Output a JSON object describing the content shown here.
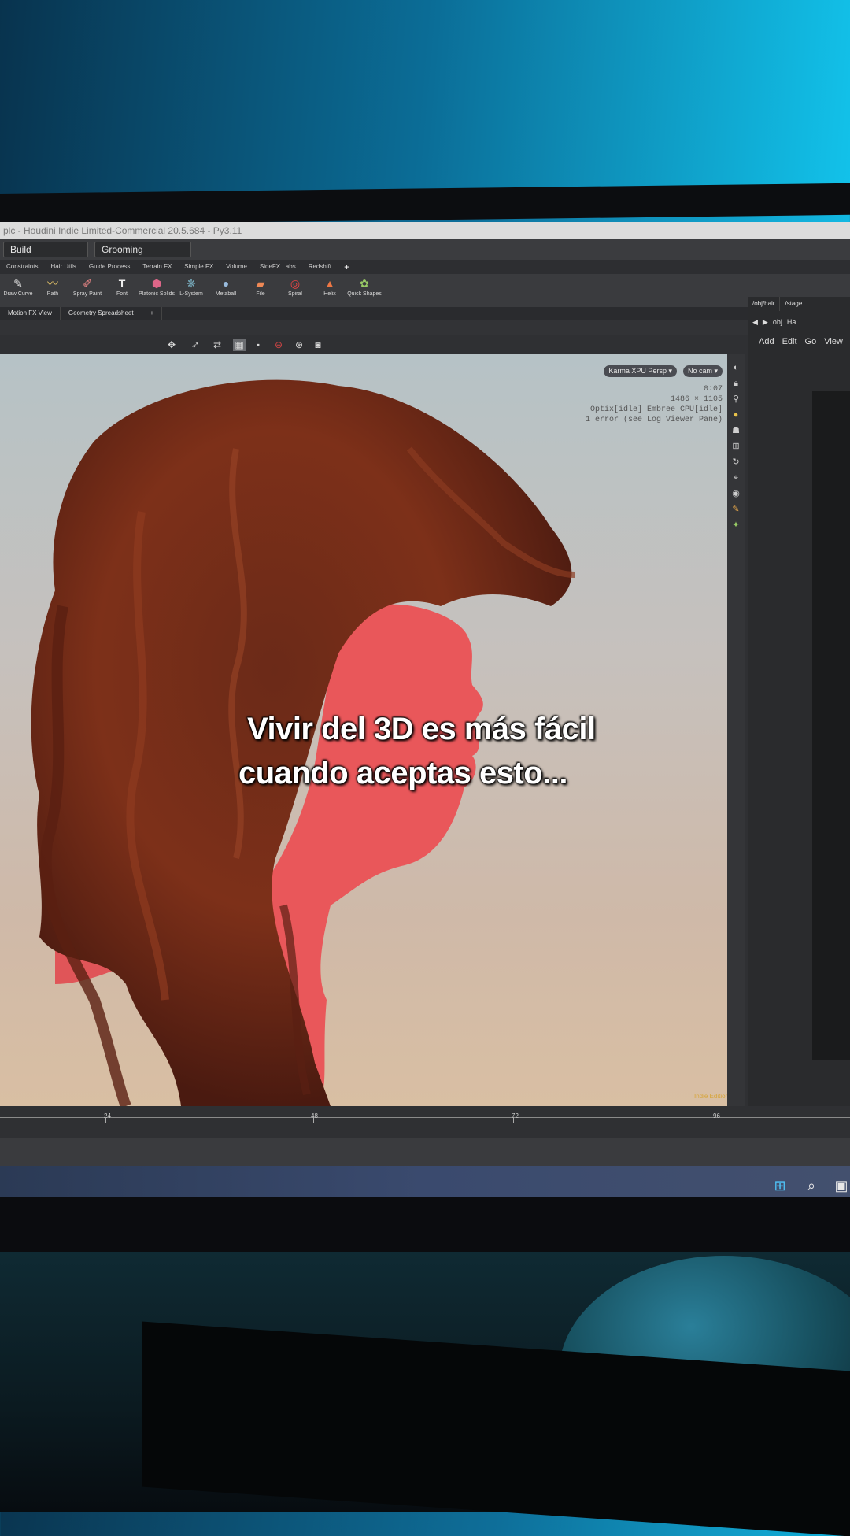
{
  "window": {
    "title": "plc - Houdini Indie Limited-Commercial 20.5.684 - Py3.11"
  },
  "desktop": {
    "build": "Build",
    "grooming": "Grooming"
  },
  "shelf_tabs": [
    "Constraints",
    "Hair Utils",
    "Guide Process",
    "Terrain FX",
    "Simple FX",
    "Volume",
    "SideFX Labs",
    "Redshift",
    "+"
  ],
  "shelf_tools": [
    {
      "label": "Draw Curve",
      "icon": "pencil-icon"
    },
    {
      "label": "Path",
      "icon": "path-icon"
    },
    {
      "label": "Spray Paint",
      "icon": "spray-icon"
    },
    {
      "label": "Font",
      "icon": "font-icon"
    },
    {
      "label": "Platonic Solids",
      "icon": "platonic-icon"
    },
    {
      "label": "L-System",
      "icon": "lsystem-icon"
    },
    {
      "label": "Metaball",
      "icon": "metaball-icon"
    },
    {
      "label": "File",
      "icon": "file-icon"
    },
    {
      "label": "Spiral",
      "icon": "spiral-icon"
    },
    {
      "label": "Helix",
      "icon": "helix-icon"
    },
    {
      "label": "Quick Shapes",
      "icon": "quickshapes-icon"
    }
  ],
  "pane_tabs": [
    "Motion FX View",
    "Geometry Spreadsheet",
    "+"
  ],
  "viewport": {
    "renderer_pill": "Karma XPU Persp ▾",
    "camera_pill": "No cam ▾",
    "hud": [
      "0:07",
      "1486 × 1105",
      "Optix[idle] Embree CPU[idle]",
      "1 error (see Log Viewer Pane)"
    ],
    "watermark": "Indie Edition"
  },
  "network": {
    "tabs": [
      "/obj/hair",
      "/stage"
    ],
    "path": [
      "obj",
      "Ha"
    ],
    "menu": [
      "Add",
      "Edit",
      "Go",
      "View"
    ]
  },
  "timeline": {
    "ticks": [
      "24",
      "48",
      "72",
      "96"
    ]
  },
  "caption": {
    "line1": "Vivir del 3D es más fácil",
    "line2": "cuando aceptas esto..."
  }
}
